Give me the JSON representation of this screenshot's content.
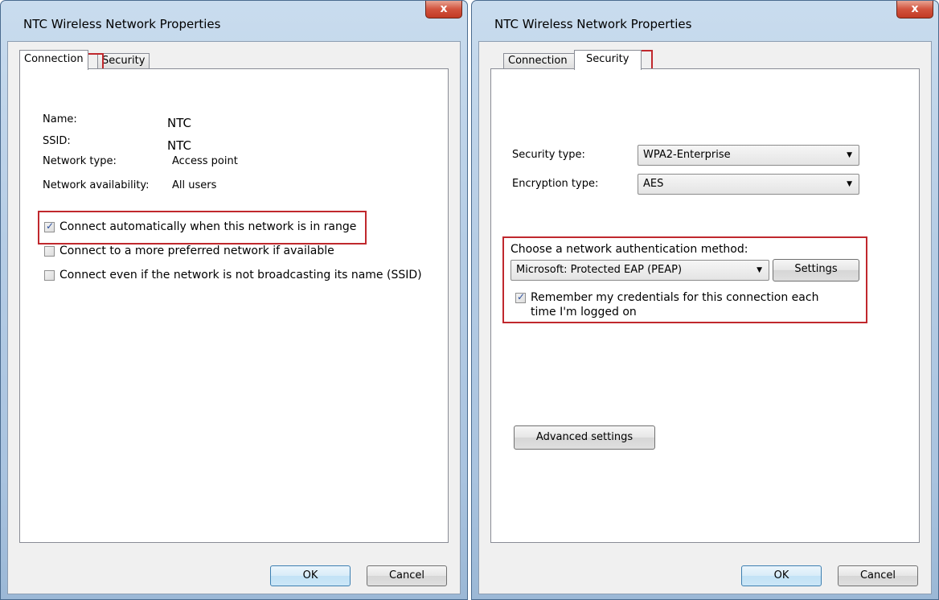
{
  "left_window": {
    "title": "NTC Wireless Network Properties",
    "close_label": "x",
    "tabs": [
      {
        "label": "Connection",
        "active": true
      },
      {
        "label": "Security",
        "active": false
      }
    ],
    "fields": [
      {
        "label": "Name:",
        "value": "NTC"
      },
      {
        "label": "SSID:",
        "value": "NTC"
      },
      {
        "label": "Network type:",
        "value": "Access point"
      },
      {
        "label": "Network availability:",
        "value": "All users"
      }
    ],
    "checkboxes": [
      {
        "label": "Connect automatically when this network is in range",
        "checked": true
      },
      {
        "label": "Connect to a more preferred network if available",
        "checked": false
      },
      {
        "label": "Connect even if the network is not broadcasting its name (SSID)",
        "checked": false
      }
    ],
    "ok_label": "OK",
    "cancel_label": "Cancel"
  },
  "right_window": {
    "title": "NTC Wireless Network Properties",
    "close_label": "x",
    "tabs": [
      {
        "label": "Connection",
        "active": false
      },
      {
        "label": "Security",
        "active": true
      }
    ],
    "security_type_label": "Security type:",
    "security_type_value": "WPA2-Enterprise",
    "encryption_type_label": "Encryption type:",
    "encryption_type_value": "AES",
    "auth_method_label": "Choose a network authentication method:",
    "auth_method_value": "Microsoft: Protected EAP (PEAP)",
    "settings_label": "Settings",
    "remember_label_line1": "Remember my credentials for this connection each",
    "remember_label_line2": "time I'm logged on",
    "remember_checked": true,
    "advanced_label": "Advanced settings",
    "ok_label": "OK",
    "cancel_label": "Cancel"
  },
  "colors": {
    "highlight_box": "#c0282d",
    "frame_blue": "#a9c3df"
  }
}
